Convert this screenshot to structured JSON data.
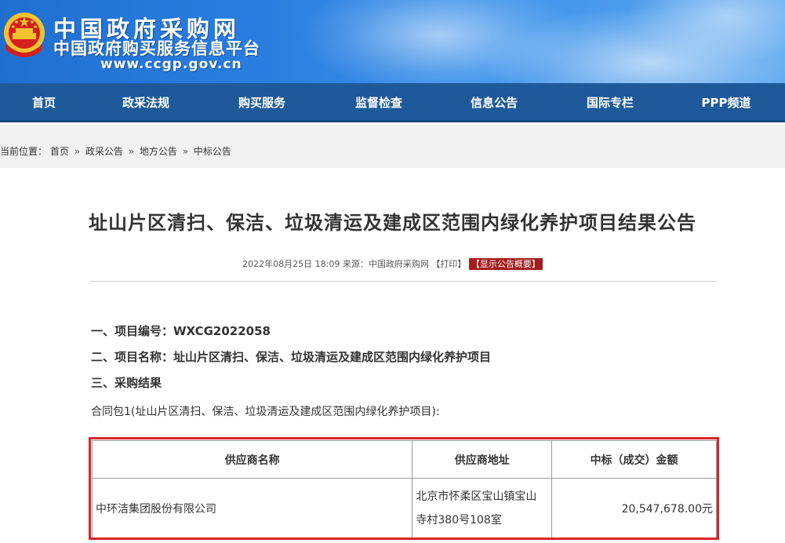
{
  "header": {
    "site_name": "中国政府采购网",
    "site_subtitle": "中国政府购买服务信息平台",
    "site_url": "www.ccgp.gov.cn"
  },
  "nav": {
    "items": [
      {
        "label": "首页"
      },
      {
        "label": "政采法规"
      },
      {
        "label": "购买服务"
      },
      {
        "label": "监督检查"
      },
      {
        "label": "信息公告"
      },
      {
        "label": "国际专栏"
      },
      {
        "label": "PPP频道"
      }
    ]
  },
  "breadcrumb": {
    "prefix": "当前位置：",
    "items": [
      "首页",
      "政采公告",
      "地方公告",
      "中标公告"
    ],
    "separator": "»"
  },
  "article": {
    "title": "址山片区清扫、保洁、垃圾清运及建成区范围内绿化养护项目结果公告",
    "meta_date": "2022年08月25日 18:09 来源：",
    "meta_source": "中国政府采购网",
    "meta_print": "【打印】",
    "meta_summary": "【显示公告概要】",
    "section1": "一、项目编号：WXCG2022058",
    "section2": "二、项目名称：址山片区清扫、保洁、垃圾清运及建成区范围内绿化养护项目",
    "section3": "三、采购结果",
    "contract_pkg": "合同包1(址山片区清扫、保洁、垃圾清运及建成区范围内绿化养护项目):"
  },
  "results_table": {
    "headers": [
      "供应商名称",
      "供应商地址",
      "中标（成交）金额"
    ],
    "rows": [
      {
        "supplier": "中环洁集团股份有限公司",
        "address": "北京市怀柔区宝山镇宝山寺村380号108室",
        "amount": "20,547,678.00元"
      }
    ]
  },
  "colors": {
    "nav_bg": "#1e5a9a",
    "banner_blue": "#2b7fe0",
    "highlight_red": "#d7262b",
    "summary_btn": "#a51c1c"
  }
}
